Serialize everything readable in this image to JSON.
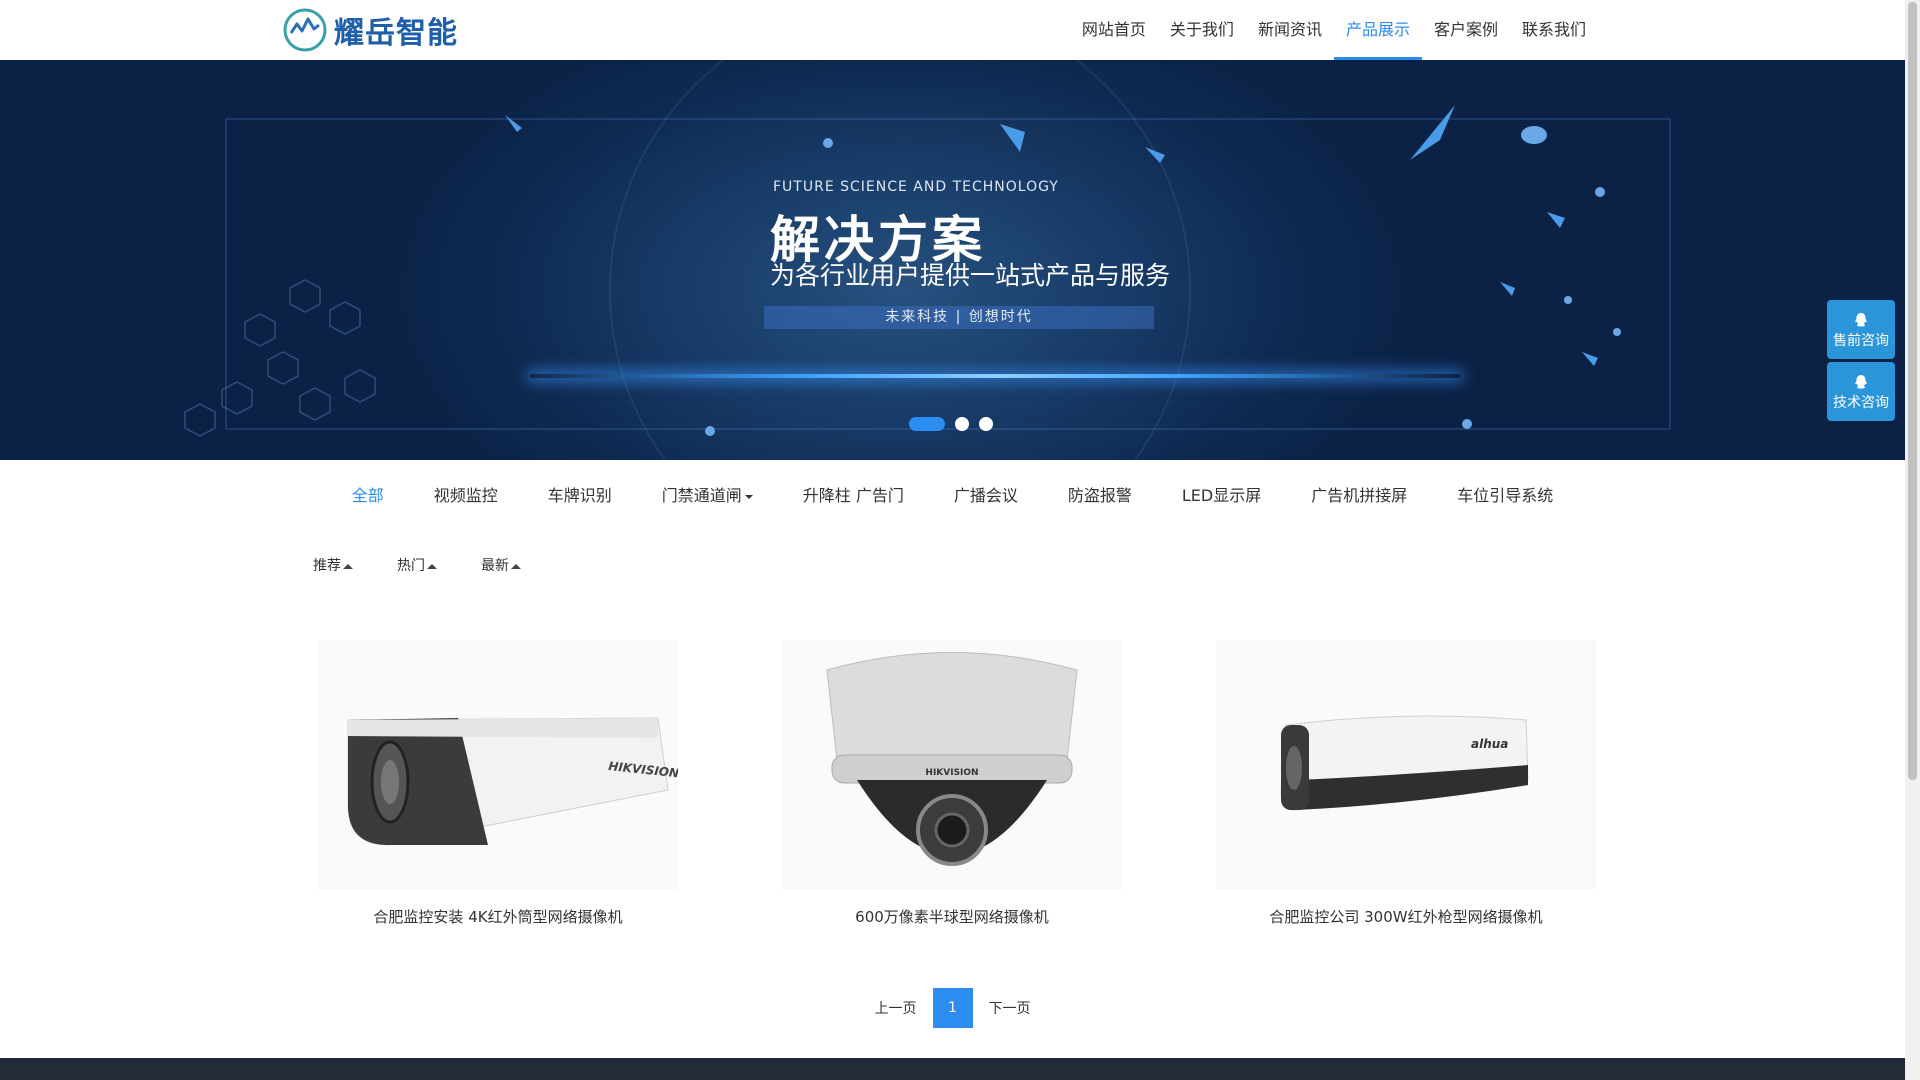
{
  "header": {
    "logo_text": "耀岳智能",
    "nav": [
      "网站首页",
      "关于我们",
      "新闻资讯",
      "产品展示",
      "客户案例",
      "联系我们"
    ],
    "active_nav_index": 3
  },
  "banner": {
    "subtitle": "FUTURE SCIENCE AND TECHNOLOGY",
    "title": "解决方案",
    "description": "为各行业用户提供一站式产品与服务",
    "tagline": "未来科技 | 创想时代",
    "slide_count": 3,
    "active_slide": 1
  },
  "float": {
    "presale": "售前咨询",
    "tech": "技术咨询"
  },
  "categories": [
    "全部",
    "视频监控",
    "车牌识别",
    "门禁通道闸",
    "升降柱 广告门",
    "广播会议",
    "防盗报警",
    "LED显示屏",
    "广告机拼接屏",
    "车位引导系统"
  ],
  "active_category": "全部",
  "dropdown_category": "门禁通道闸",
  "sorts": [
    "推荐",
    "热门",
    "最新"
  ],
  "products": [
    {
      "name": "合肥监控安装 4K红外筒型网络摄像机",
      "brand_mark": "HIKVISION",
      "icon": "bullet-camera-image"
    },
    {
      "name": "600万像素半球型网络摄像机",
      "brand_mark": "HIKVISION",
      "icon": "dome-camera-image"
    },
    {
      "name": "合肥监控公司 300W红外枪型网络摄像机",
      "brand_mark": "alhua",
      "icon": "box-camera-image"
    }
  ],
  "pagination": {
    "prev": "上一页",
    "current": "1",
    "next": "下一页"
  },
  "colors": {
    "accent": "#2d8cf0",
    "logo": "#1f5ea8",
    "float": "#2a95d8",
    "footer": "#232a38"
  }
}
